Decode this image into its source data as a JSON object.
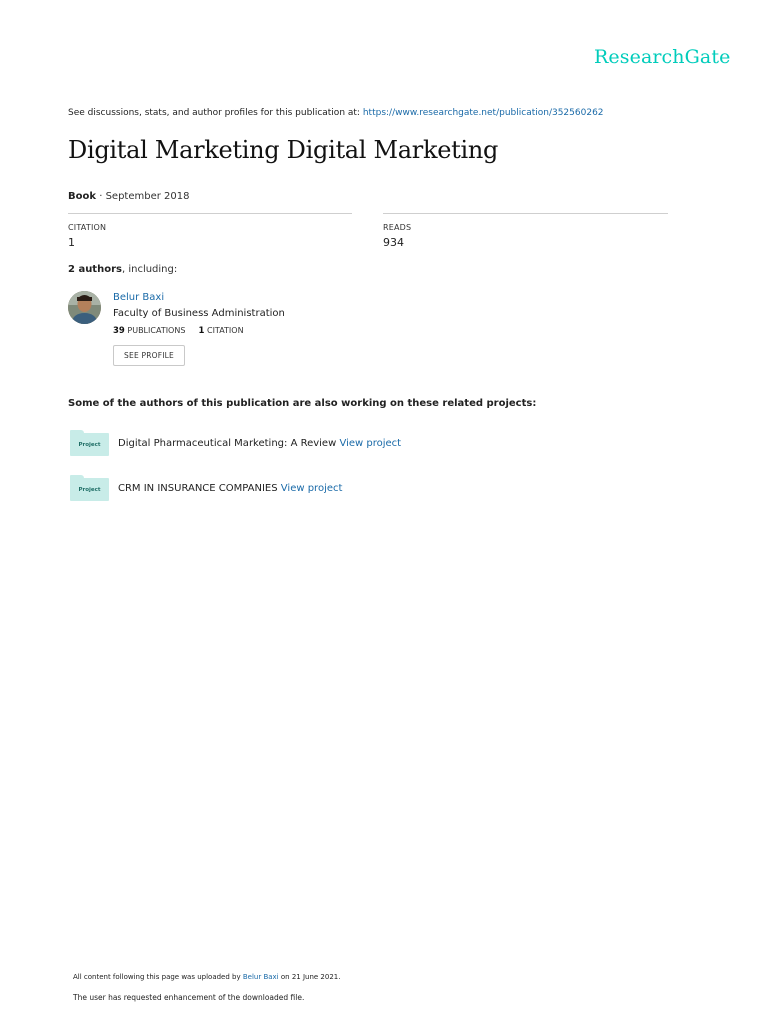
{
  "brand": {
    "logo": "ResearchGate",
    "color": "#00ccbb"
  },
  "header": {
    "discussions_text": "See discussions, stats, and author profiles for this publication at:",
    "url": "https://www.researchgate.net/publication/352560262"
  },
  "publication": {
    "title": "Digital Marketing Digital Marketing",
    "type": "Book",
    "separator": " · ",
    "date": "September 2018"
  },
  "stats": {
    "citation_label": "CITATION",
    "citation_value": "1",
    "reads_label": "READS",
    "reads_value": "934"
  },
  "authors": {
    "count_text": "2 authors",
    "including_text": ", including:",
    "items": [
      {
        "name": "Belur Baxi",
        "affiliation": "Faculty of Business Administration",
        "publications_count": "39",
        "publications_label": "PUBLICATIONS",
        "citations_count": "1",
        "citations_label": "CITATION",
        "button_label": "SEE PROFILE"
      }
    ]
  },
  "related": {
    "heading": "Some of the authors of this publication are also working on these related projects:",
    "projects": [
      {
        "icon_label": "Project",
        "title": "Digital Pharmaceutical Marketing: A Review",
        "link": "View project"
      },
      {
        "icon_label": "Project",
        "title": "CRM IN INSURANCE COMPANIES",
        "link": "View project"
      }
    ]
  },
  "footer": {
    "uploaded_prefix": "All content following this page was uploaded by",
    "uploader": "Belur Baxi",
    "uploaded_suffix": "on 21 June 2021.",
    "notice": "The user has requested enhancement of the downloaded file."
  }
}
